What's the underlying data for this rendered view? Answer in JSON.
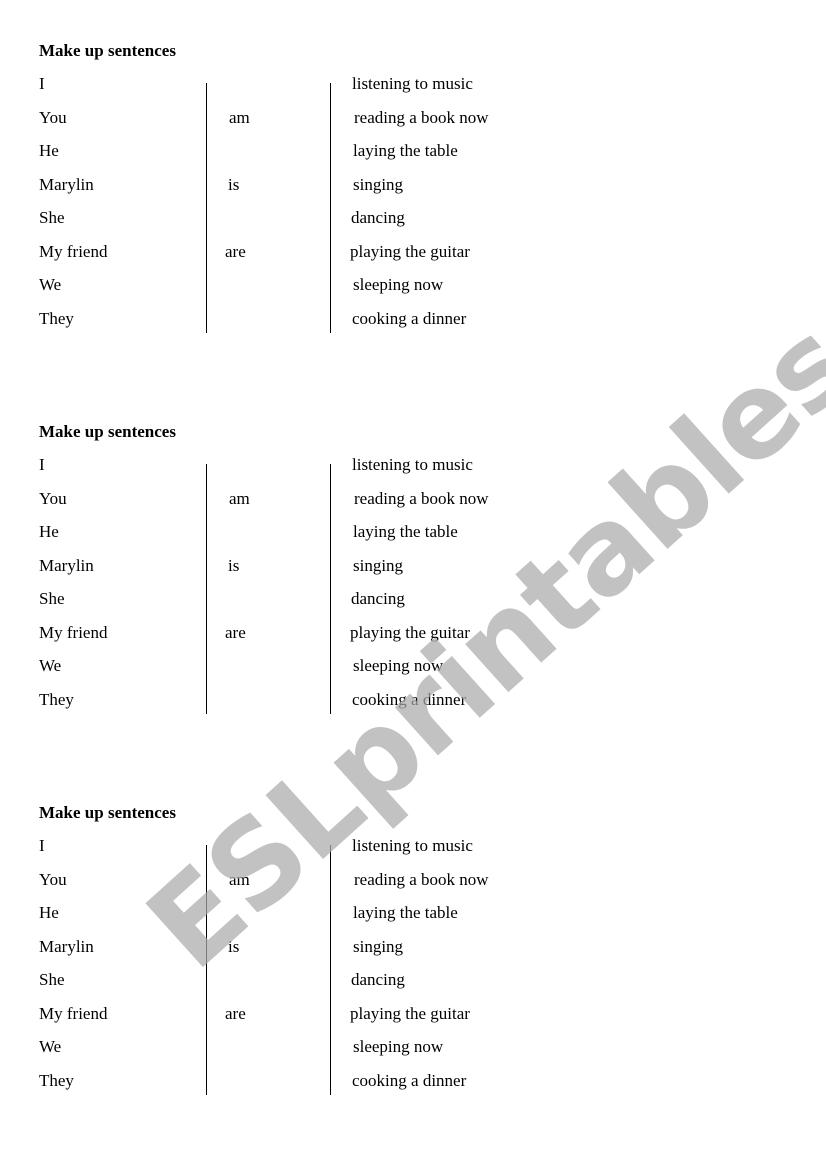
{
  "worksheet": {
    "blocks": [
      {
        "title": "Make up sentences",
        "subjects": [
          "I",
          "You",
          "He",
          "Marylin",
          "She",
          "My friend",
          "We",
          "They"
        ],
        "verbs": [
          "am",
          "is",
          "are"
        ],
        "phrases": [
          "listening to music",
          "reading a book now",
          "laying the table",
          "singing",
          "dancing",
          "playing the guitar",
          "sleeping now",
          "cooking a dinner"
        ]
      },
      {
        "title": "Make up sentences",
        "subjects": [
          "I",
          "You",
          "He",
          "Marylin",
          "She",
          "My friend",
          "We",
          "They"
        ],
        "verbs": [
          "am",
          "is",
          "are"
        ],
        "phrases": [
          "listening to music",
          "reading a book now",
          "laying the table",
          "singing",
          "dancing",
          "playing the guitar",
          "sleeping now",
          "cooking a dinner"
        ]
      },
      {
        "title": "Make up sentences",
        "subjects": [
          "I",
          "You",
          "He",
          "Marylin",
          "She",
          "My friend",
          "We",
          "They"
        ],
        "verbs": [
          "am",
          "is",
          "are"
        ],
        "phrases": [
          "listening to music",
          "reading a book now",
          "laying the table",
          "singing",
          "dancing",
          "playing the guitar",
          "sleeping now",
          "cooking a dinner"
        ]
      }
    ]
  },
  "watermark": {
    "text": "ESLprintables.com",
    "color": "#b4b4b4"
  }
}
